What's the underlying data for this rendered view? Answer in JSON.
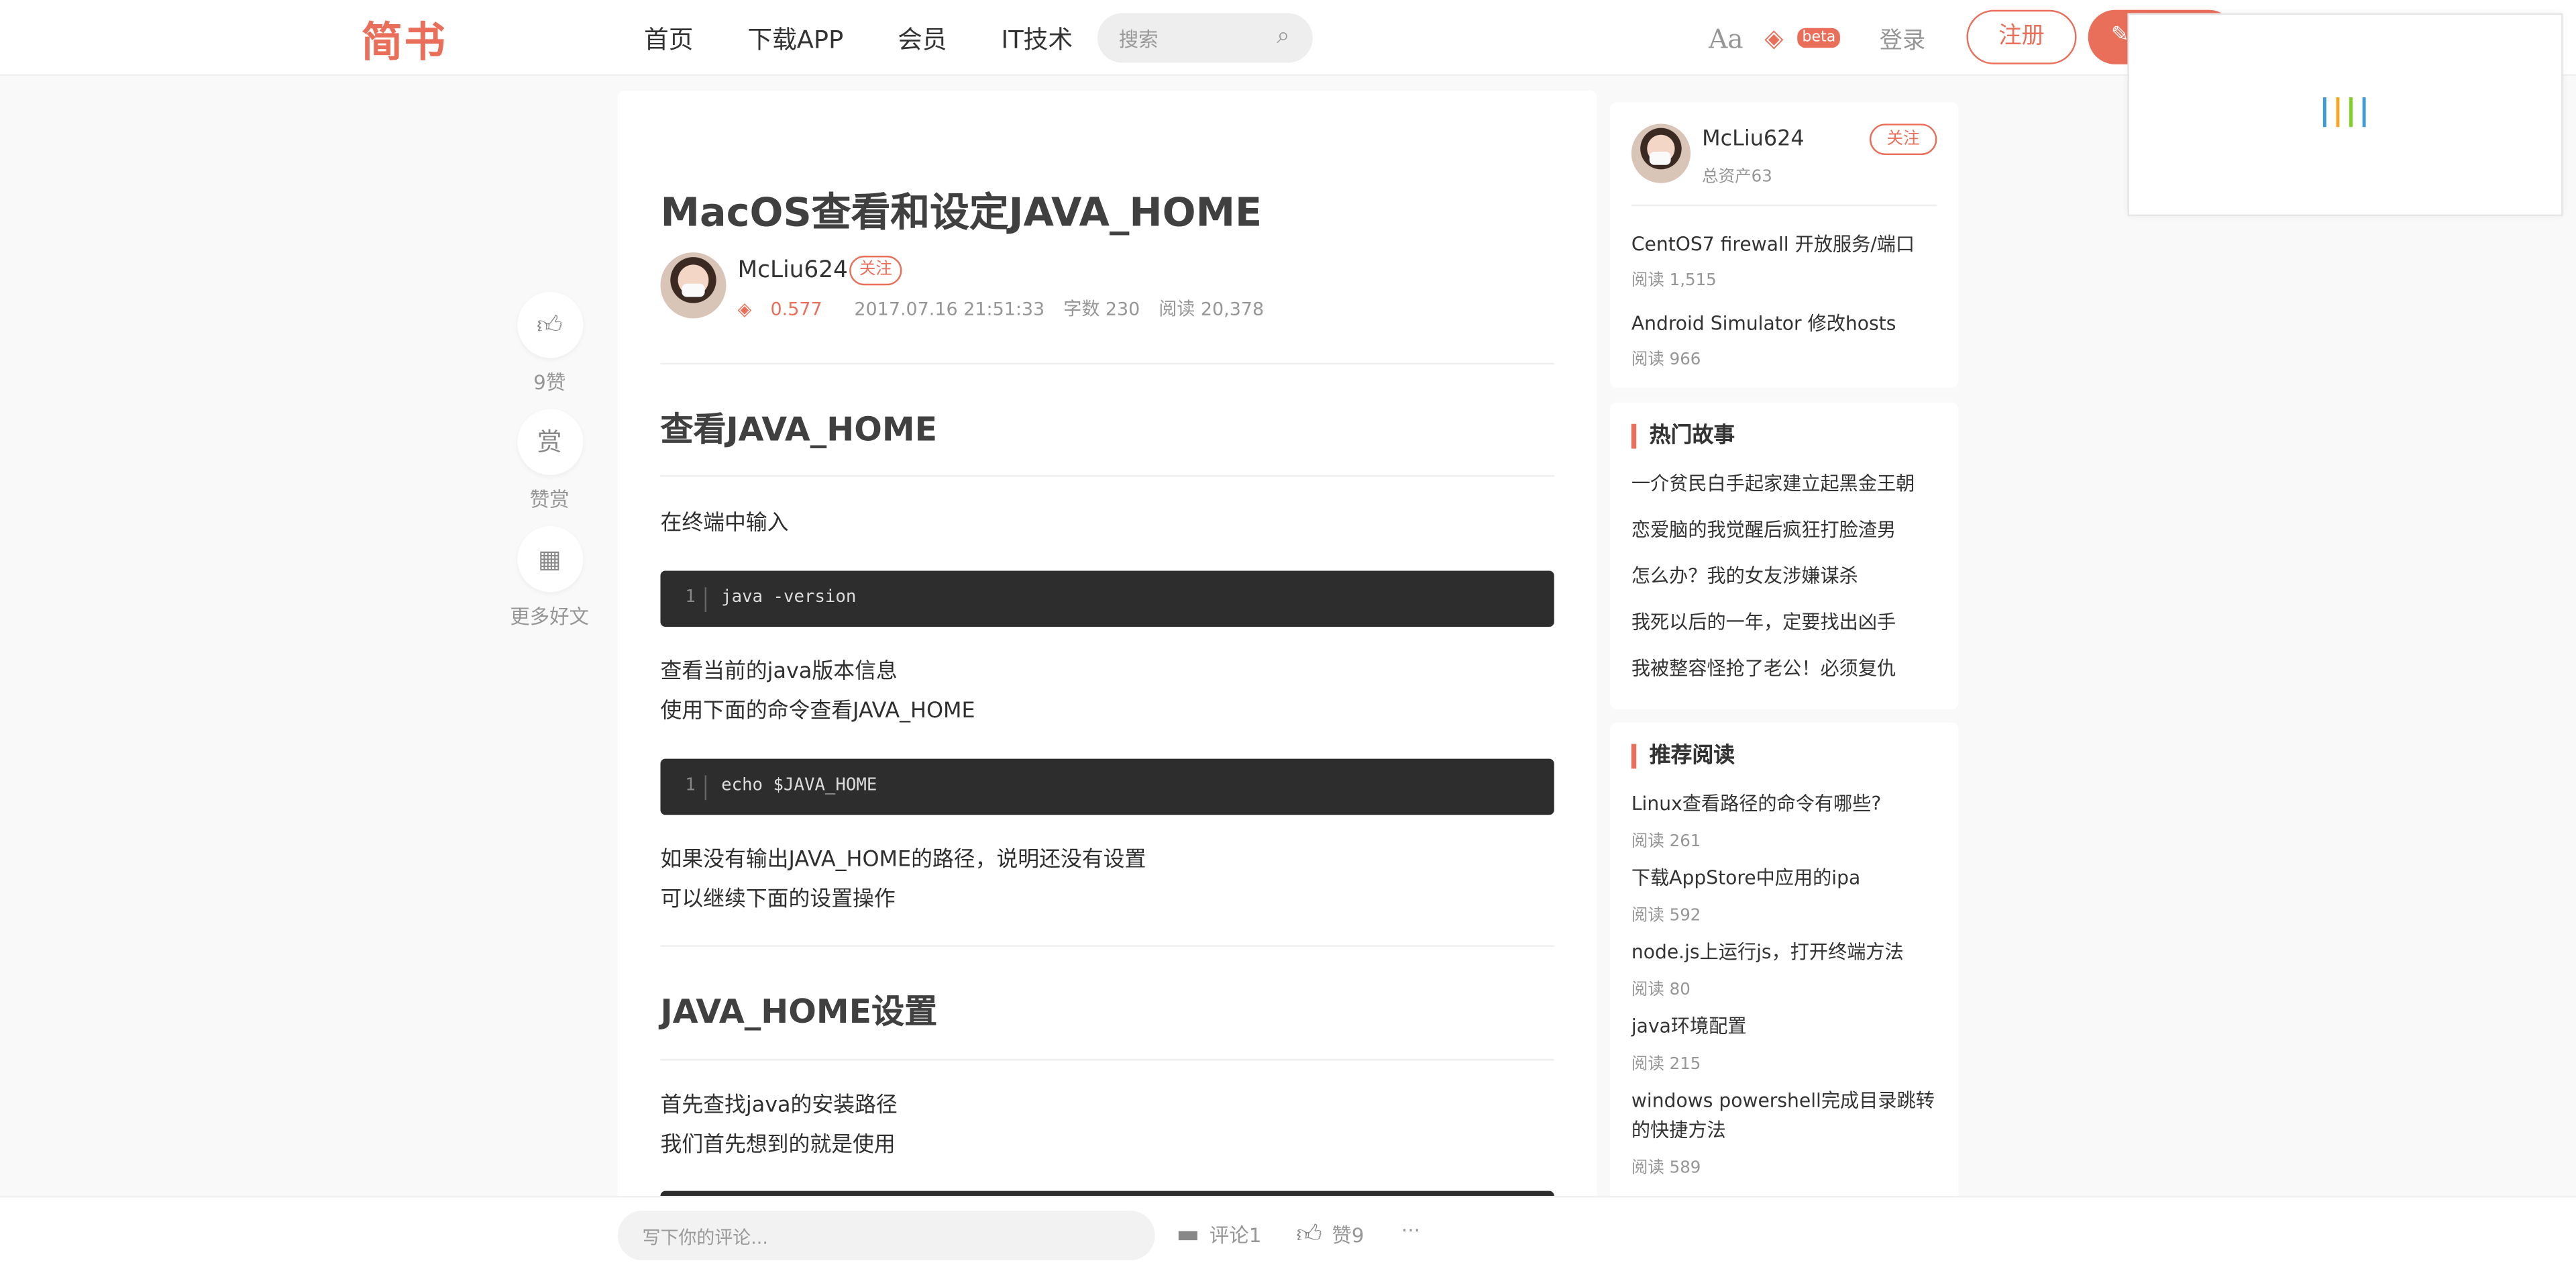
{
  "nav": {
    "logo": "简书",
    "links": [
      "首页",
      "下载APP",
      "会员",
      "IT技术"
    ],
    "search_placeholder": "搜索",
    "font_toggle": "Aa",
    "beta": "beta",
    "login": "登录",
    "register": "注册"
  },
  "side_actions": [
    {
      "icon": "thumbs-up-icon",
      "label": "9赞"
    },
    {
      "icon": "reward-icon",
      "glyph": "赏",
      "label": "赞赏"
    },
    {
      "icon": "qrcode-icon",
      "label": "更多好文"
    }
  ],
  "article": {
    "title": "MacOS查看和设定JAVA_HOME",
    "author": "McLiu624",
    "follow": "关注",
    "diamond": "0.577",
    "date": "2017.07.16 21:51:33",
    "words": "字数 230",
    "reads": "阅读 20,378",
    "h1": "查看JAVA_HOME",
    "p1": "在终端中输入",
    "code1": {
      "line": "1",
      "text": "java -version"
    },
    "p2a": "查看当前的java版本信息",
    "p2b": "使用下面的命令查看JAVA_HOME",
    "code2": {
      "line": "1",
      "text": "echo $JAVA_HOME"
    },
    "p3a": "如果没有输出JAVA_HOME的路径，说明还没有设置",
    "p3b": "可以继续下面的设置操作",
    "h2": "JAVA_HOME设置",
    "p4a": "首先查找java的安装路径",
    "p4b": "我们首先想到的就是使用"
  },
  "author_card": {
    "name": "McLiu624",
    "assets": "总资产63",
    "follow": "关注",
    "posts": [
      {
        "title": "CentOS7 firewall 开放服务/端口",
        "reads": "阅读 1,515"
      },
      {
        "title": "Android Simulator 修改hosts",
        "reads": "阅读 966"
      }
    ]
  },
  "hot": {
    "heading": "热门故事",
    "items": [
      "一介贫民白手起家建立起黑金王朝",
      "恋爱脑的我觉醒后疯狂打脸渣男",
      "怎么办？我的女友涉嫌谋杀",
      "我死以后的一年，定要找出凶手",
      "我被整容怪抢了老公！必须复仇"
    ]
  },
  "recommend": {
    "heading": "推荐阅读",
    "items": [
      {
        "title": "Linux查看路径的命令有哪些?",
        "reads": "阅读 261"
      },
      {
        "title": "下载AppStore中应用的ipa",
        "reads": "阅读 592"
      },
      {
        "title": "node.js上运行js，打开终端方法",
        "reads": "阅读 80"
      },
      {
        "title": "java环境配置",
        "reads": "阅读 215"
      },
      {
        "title": "windows powershell完成目录跳转的快捷方法",
        "reads": "阅读 589"
      }
    ]
  },
  "bottom": {
    "comment_placeholder": "写下你的评论...",
    "comments": "评论1",
    "likes": "赞9",
    "more": "···"
  },
  "colors": {
    "accent": "#ea6f5a",
    "code_bg": "#2d2d2d",
    "loader": [
      "#3d9bd8",
      "#f5a623",
      "#7ed321",
      "#3d9bd8"
    ]
  }
}
